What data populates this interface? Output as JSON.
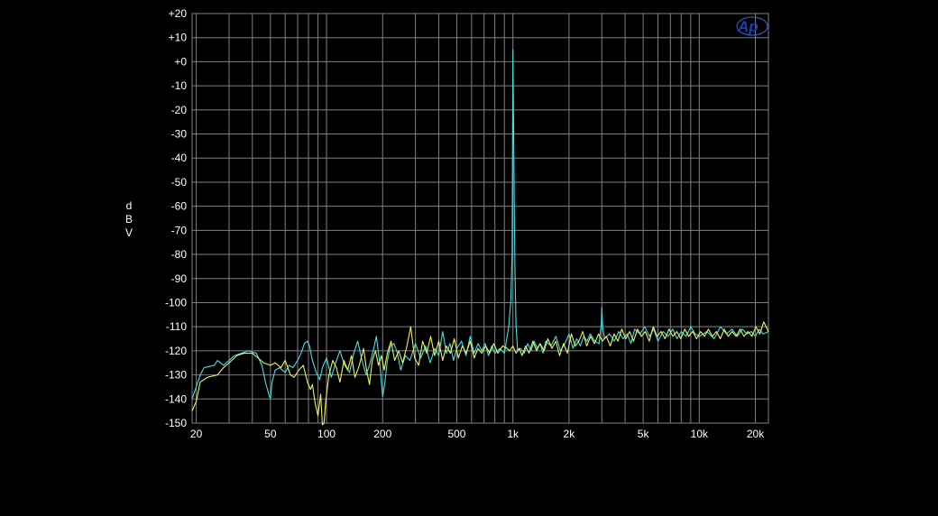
{
  "chart_data": {
    "type": "line",
    "title": "",
    "xlabel": "",
    "ylabel": "dBV",
    "ylabel_chars": [
      "d",
      "B",
      "V"
    ],
    "x_scale": "log",
    "xlim": [
      19,
      23500
    ],
    "ylim": [
      -150,
      20
    ],
    "grid": true,
    "legend": "none",
    "x_ticks": [
      {
        "value": 20,
        "label": "20"
      },
      {
        "value": 50,
        "label": "50"
      },
      {
        "value": 100,
        "label": "100"
      },
      {
        "value": 200,
        "label": "200"
      },
      {
        "value": 500,
        "label": "500"
      },
      {
        "value": 1000,
        "label": "1k"
      },
      {
        "value": 2000,
        "label": "2k"
      },
      {
        "value": 5000,
        "label": "5k"
      },
      {
        "value": 10000,
        "label": "10k"
      },
      {
        "value": 20000,
        "label": "20k"
      }
    ],
    "y_ticks": [
      {
        "value": 20,
        "label": "+20"
      },
      {
        "value": 10,
        "label": "+10"
      },
      {
        "value": 0,
        "label": "+0"
      },
      {
        "value": -10,
        "label": "-10"
      },
      {
        "value": -20,
        "label": "-20"
      },
      {
        "value": -30,
        "label": "-30"
      },
      {
        "value": -40,
        "label": "-40"
      },
      {
        "value": -50,
        "label": "-50"
      },
      {
        "value": -60,
        "label": "-60"
      },
      {
        "value": -70,
        "label": "-70"
      },
      {
        "value": -80,
        "label": "-80"
      },
      {
        "value": -90,
        "label": "-90"
      },
      {
        "value": -100,
        "label": "-100"
      },
      {
        "value": -110,
        "label": "-110"
      },
      {
        "value": -120,
        "label": "-120"
      },
      {
        "value": -130,
        "label": "-130"
      },
      {
        "value": -140,
        "label": "-140"
      },
      {
        "value": -150,
        "label": "-150"
      }
    ],
    "series": [
      {
        "color": "#40e0e8",
        "points": [
          [
            19,
            -140
          ],
          [
            21,
            -130
          ],
          [
            22,
            -127
          ],
          [
            25,
            -126
          ],
          [
            26,
            -124
          ],
          [
            28,
            -126
          ],
          [
            30,
            -124
          ],
          [
            32,
            -122
          ],
          [
            35,
            -121
          ],
          [
            38,
            -120
          ],
          [
            42,
            -121
          ],
          [
            45,
            -126
          ],
          [
            47,
            -133
          ],
          [
            49,
            -138
          ],
          [
            50,
            -140
          ],
          [
            51,
            -133
          ],
          [
            53,
            -128
          ],
          [
            56,
            -127
          ],
          [
            60,
            -129
          ],
          [
            63,
            -126
          ],
          [
            66,
            -127
          ],
          [
            70,
            -124
          ],
          [
            73,
            -121
          ],
          [
            76,
            -117
          ],
          [
            79,
            -116
          ],
          [
            81,
            -118
          ],
          [
            84,
            -124
          ],
          [
            88,
            -129
          ],
          [
            92,
            -132
          ],
          [
            95,
            -127
          ],
          [
            100,
            -123
          ],
          [
            106,
            -131
          ],
          [
            112,
            -125
          ],
          [
            118,
            -120
          ],
          [
            125,
            -126
          ],
          [
            133,
            -129
          ],
          [
            140,
            -121
          ],
          [
            147,
            -116
          ],
          [
            155,
            -124
          ],
          [
            163,
            -130
          ],
          [
            170,
            -126
          ],
          [
            178,
            -120
          ],
          [
            185,
            -114
          ],
          [
            193,
            -125
          ],
          [
            200,
            -139
          ],
          [
            205,
            -134
          ],
          [
            212,
            -124
          ],
          [
            220,
            -118
          ],
          [
            230,
            -117
          ],
          [
            240,
            -121
          ],
          [
            250,
            -128
          ],
          [
            265,
            -122
          ],
          [
            280,
            -124
          ],
          [
            300,
            -117
          ],
          [
            320,
            -123
          ],
          [
            340,
            -118
          ],
          [
            360,
            -125
          ],
          [
            380,
            -119
          ],
          [
            400,
            -122
          ],
          [
            420,
            -112
          ],
          [
            440,
            -121
          ],
          [
            460,
            -117
          ],
          [
            480,
            -124
          ],
          [
            500,
            -119
          ],
          [
            530,
            -116
          ],
          [
            560,
            -122
          ],
          [
            590,
            -114
          ],
          [
            620,
            -121
          ],
          [
            650,
            -117
          ],
          [
            680,
            -120
          ],
          [
            710,
            -117
          ],
          [
            740,
            -122
          ],
          [
            770,
            -118
          ],
          [
            800,
            -121
          ],
          [
            850,
            -119
          ],
          [
            900,
            -121
          ],
          [
            950,
            -110
          ],
          [
            975,
            -99
          ],
          [
            990,
            -80
          ],
          [
            1000,
            5
          ],
          [
            1012,
            -40
          ],
          [
            1025,
            -85
          ],
          [
            1040,
            -110
          ],
          [
            1060,
            -120
          ],
          [
            1100,
            -119
          ],
          [
            1150,
            -121
          ],
          [
            1200,
            -117
          ],
          [
            1250,
            -120
          ],
          [
            1300,
            -116
          ],
          [
            1350,
            -119
          ],
          [
            1400,
            -117
          ],
          [
            1450,
            -121
          ],
          [
            1500,
            -116
          ],
          [
            1600,
            -118
          ],
          [
            1700,
            -114
          ],
          [
            1800,
            -120
          ],
          [
            1900,
            -117
          ],
          [
            2000,
            -113
          ],
          [
            2100,
            -119
          ],
          [
            2200,
            -115
          ],
          [
            2300,
            -118
          ],
          [
            2400,
            -114
          ],
          [
            2500,
            -116
          ],
          [
            2600,
            -113
          ],
          [
            2750,
            -116
          ],
          [
            2900,
            -117
          ],
          [
            2980,
            -109
          ],
          [
            3000,
            -102
          ],
          [
            3030,
            -110
          ],
          [
            3100,
            -115
          ],
          [
            3300,
            -113
          ],
          [
            3500,
            -116
          ],
          [
            3700,
            -112
          ],
          [
            3900,
            -115
          ],
          [
            4100,
            -113
          ],
          [
            4300,
            -117
          ],
          [
            4500,
            -111
          ],
          [
            4800,
            -113
          ],
          [
            5100,
            -110
          ],
          [
            5400,
            -114
          ],
          [
            5700,
            -111
          ],
          [
            6000,
            -116
          ],
          [
            6400,
            -112
          ],
          [
            6800,
            -114
          ],
          [
            7200,
            -111
          ],
          [
            7600,
            -115
          ],
          [
            8000,
            -112
          ],
          [
            8500,
            -114
          ],
          [
            9000,
            -110
          ],
          [
            9500,
            -113
          ],
          [
            10000,
            -114
          ],
          [
            11000,
            -112
          ],
          [
            12000,
            -115
          ],
          [
            13000,
            -110
          ],
          [
            14000,
            -113
          ],
          [
            15000,
            -111
          ],
          [
            16000,
            -114
          ],
          [
            17000,
            -111
          ],
          [
            18000,
            -113
          ],
          [
            19000,
            -112
          ],
          [
            20000,
            -114
          ],
          [
            21000,
            -111
          ],
          [
            22000,
            -113
          ],
          [
            23500,
            -112
          ]
        ]
      },
      {
        "color": "#f0f060",
        "points": [
          [
            19,
            -145
          ],
          [
            20,
            -141
          ],
          [
            21,
            -133
          ],
          [
            23,
            -131
          ],
          [
            26,
            -130
          ],
          [
            28,
            -127
          ],
          [
            30,
            -125
          ],
          [
            33,
            -122
          ],
          [
            36,
            -121
          ],
          [
            40,
            -121
          ],
          [
            43,
            -123
          ],
          [
            46,
            -125
          ],
          [
            50,
            -126
          ],
          [
            53,
            -125
          ],
          [
            57,
            -127
          ],
          [
            60,
            -124
          ],
          [
            64,
            -130
          ],
          [
            67,
            -131
          ],
          [
            71,
            -128
          ],
          [
            75,
            -126
          ],
          [
            79,
            -133
          ],
          [
            82,
            -136
          ],
          [
            84,
            -134
          ],
          [
            87,
            -142
          ],
          [
            90,
            -147
          ],
          [
            93,
            -138
          ],
          [
            95,
            -153
          ],
          [
            97,
            -150
          ],
          [
            99,
            -141
          ],
          [
            103,
            -130
          ],
          [
            108,
            -124
          ],
          [
            113,
            -127
          ],
          [
            118,
            -133
          ],
          [
            124,
            -124
          ],
          [
            130,
            -128
          ],
          [
            136,
            -122
          ],
          [
            142,
            -131
          ],
          [
            150,
            -126
          ],
          [
            158,
            -119
          ],
          [
            164,
            -128
          ],
          [
            170,
            -134
          ],
          [
            176,
            -124
          ],
          [
            183,
            -120
          ],
          [
            190,
            -126
          ],
          [
            197,
            -122
          ],
          [
            204,
            -128
          ],
          [
            212,
            -121
          ],
          [
            222,
            -116
          ],
          [
            232,
            -124
          ],
          [
            244,
            -120
          ],
          [
            256,
            -125
          ],
          [
            270,
            -118
          ],
          [
            283,
            -110
          ],
          [
            297,
            -123
          ],
          [
            312,
            -126
          ],
          [
            328,
            -116
          ],
          [
            345,
            -121
          ],
          [
            362,
            -114
          ],
          [
            380,
            -122
          ],
          [
            400,
            -116
          ],
          [
            420,
            -124
          ],
          [
            440,
            -118
          ],
          [
            462,
            -121
          ],
          [
            485,
            -115
          ],
          [
            510,
            -123
          ],
          [
            535,
            -118
          ],
          [
            562,
            -121
          ],
          [
            590,
            -116
          ],
          [
            620,
            -123
          ],
          [
            650,
            -119
          ],
          [
            680,
            -121
          ],
          [
            715,
            -118
          ],
          [
            750,
            -121
          ],
          [
            790,
            -117
          ],
          [
            830,
            -121
          ],
          [
            880,
            -118
          ],
          [
            930,
            -119
          ],
          [
            960,
            -120
          ],
          [
            1000,
            -118
          ],
          [
            1040,
            -121
          ],
          [
            1080,
            -119
          ],
          [
            1120,
            -122
          ],
          [
            1170,
            -118
          ],
          [
            1220,
            -121
          ],
          [
            1280,
            -116
          ],
          [
            1340,
            -120
          ],
          [
            1400,
            -117
          ],
          [
            1470,
            -120
          ],
          [
            1540,
            -115
          ],
          [
            1620,
            -119
          ],
          [
            1700,
            -116
          ],
          [
            1780,
            -122
          ],
          [
            1870,
            -117
          ],
          [
            1960,
            -121
          ],
          [
            2060,
            -113
          ],
          [
            2160,
            -118
          ],
          [
            2260,
            -116
          ],
          [
            2370,
            -112
          ],
          [
            2490,
            -118
          ],
          [
            2610,
            -114
          ],
          [
            2740,
            -117
          ],
          [
            2880,
            -113
          ],
          [
            3020,
            -116
          ],
          [
            3170,
            -114
          ],
          [
            3330,
            -118
          ],
          [
            3490,
            -113
          ],
          [
            3660,
            -116
          ],
          [
            3840,
            -111
          ],
          [
            4030,
            -115
          ],
          [
            4230,
            -112
          ],
          [
            4440,
            -116
          ],
          [
            4660,
            -111
          ],
          [
            4890,
            -114
          ],
          [
            5130,
            -112
          ],
          [
            5390,
            -116
          ],
          [
            5660,
            -110
          ],
          [
            5940,
            -114
          ],
          [
            6240,
            -112
          ],
          [
            6550,
            -115
          ],
          [
            6880,
            -111
          ],
          [
            7220,
            -114
          ],
          [
            7580,
            -112
          ],
          [
            7960,
            -115
          ],
          [
            8360,
            -111
          ],
          [
            8780,
            -114
          ],
          [
            9220,
            -112
          ],
          [
            9680,
            -115
          ],
          [
            10160,
            -112
          ],
          [
            10670,
            -114
          ],
          [
            11200,
            -111
          ],
          [
            11760,
            -114
          ],
          [
            12350,
            -112
          ],
          [
            12970,
            -115
          ],
          [
            13620,
            -111
          ],
          [
            14300,
            -114
          ],
          [
            15010,
            -112
          ],
          [
            15760,
            -114
          ],
          [
            16550,
            -111
          ],
          [
            17380,
            -114
          ],
          [
            18250,
            -112
          ],
          [
            19160,
            -114
          ],
          [
            20120,
            -110
          ],
          [
            21130,
            -113
          ],
          [
            22180,
            -108
          ],
          [
            23500,
            -112
          ]
        ]
      }
    ]
  },
  "logo": {
    "text": "Ap",
    "color": "#3a5fd0",
    "icon": "ap-logo-icon"
  },
  "colors": {
    "background": "#000000",
    "grid": "#808080",
    "text": "#ffffff"
  }
}
